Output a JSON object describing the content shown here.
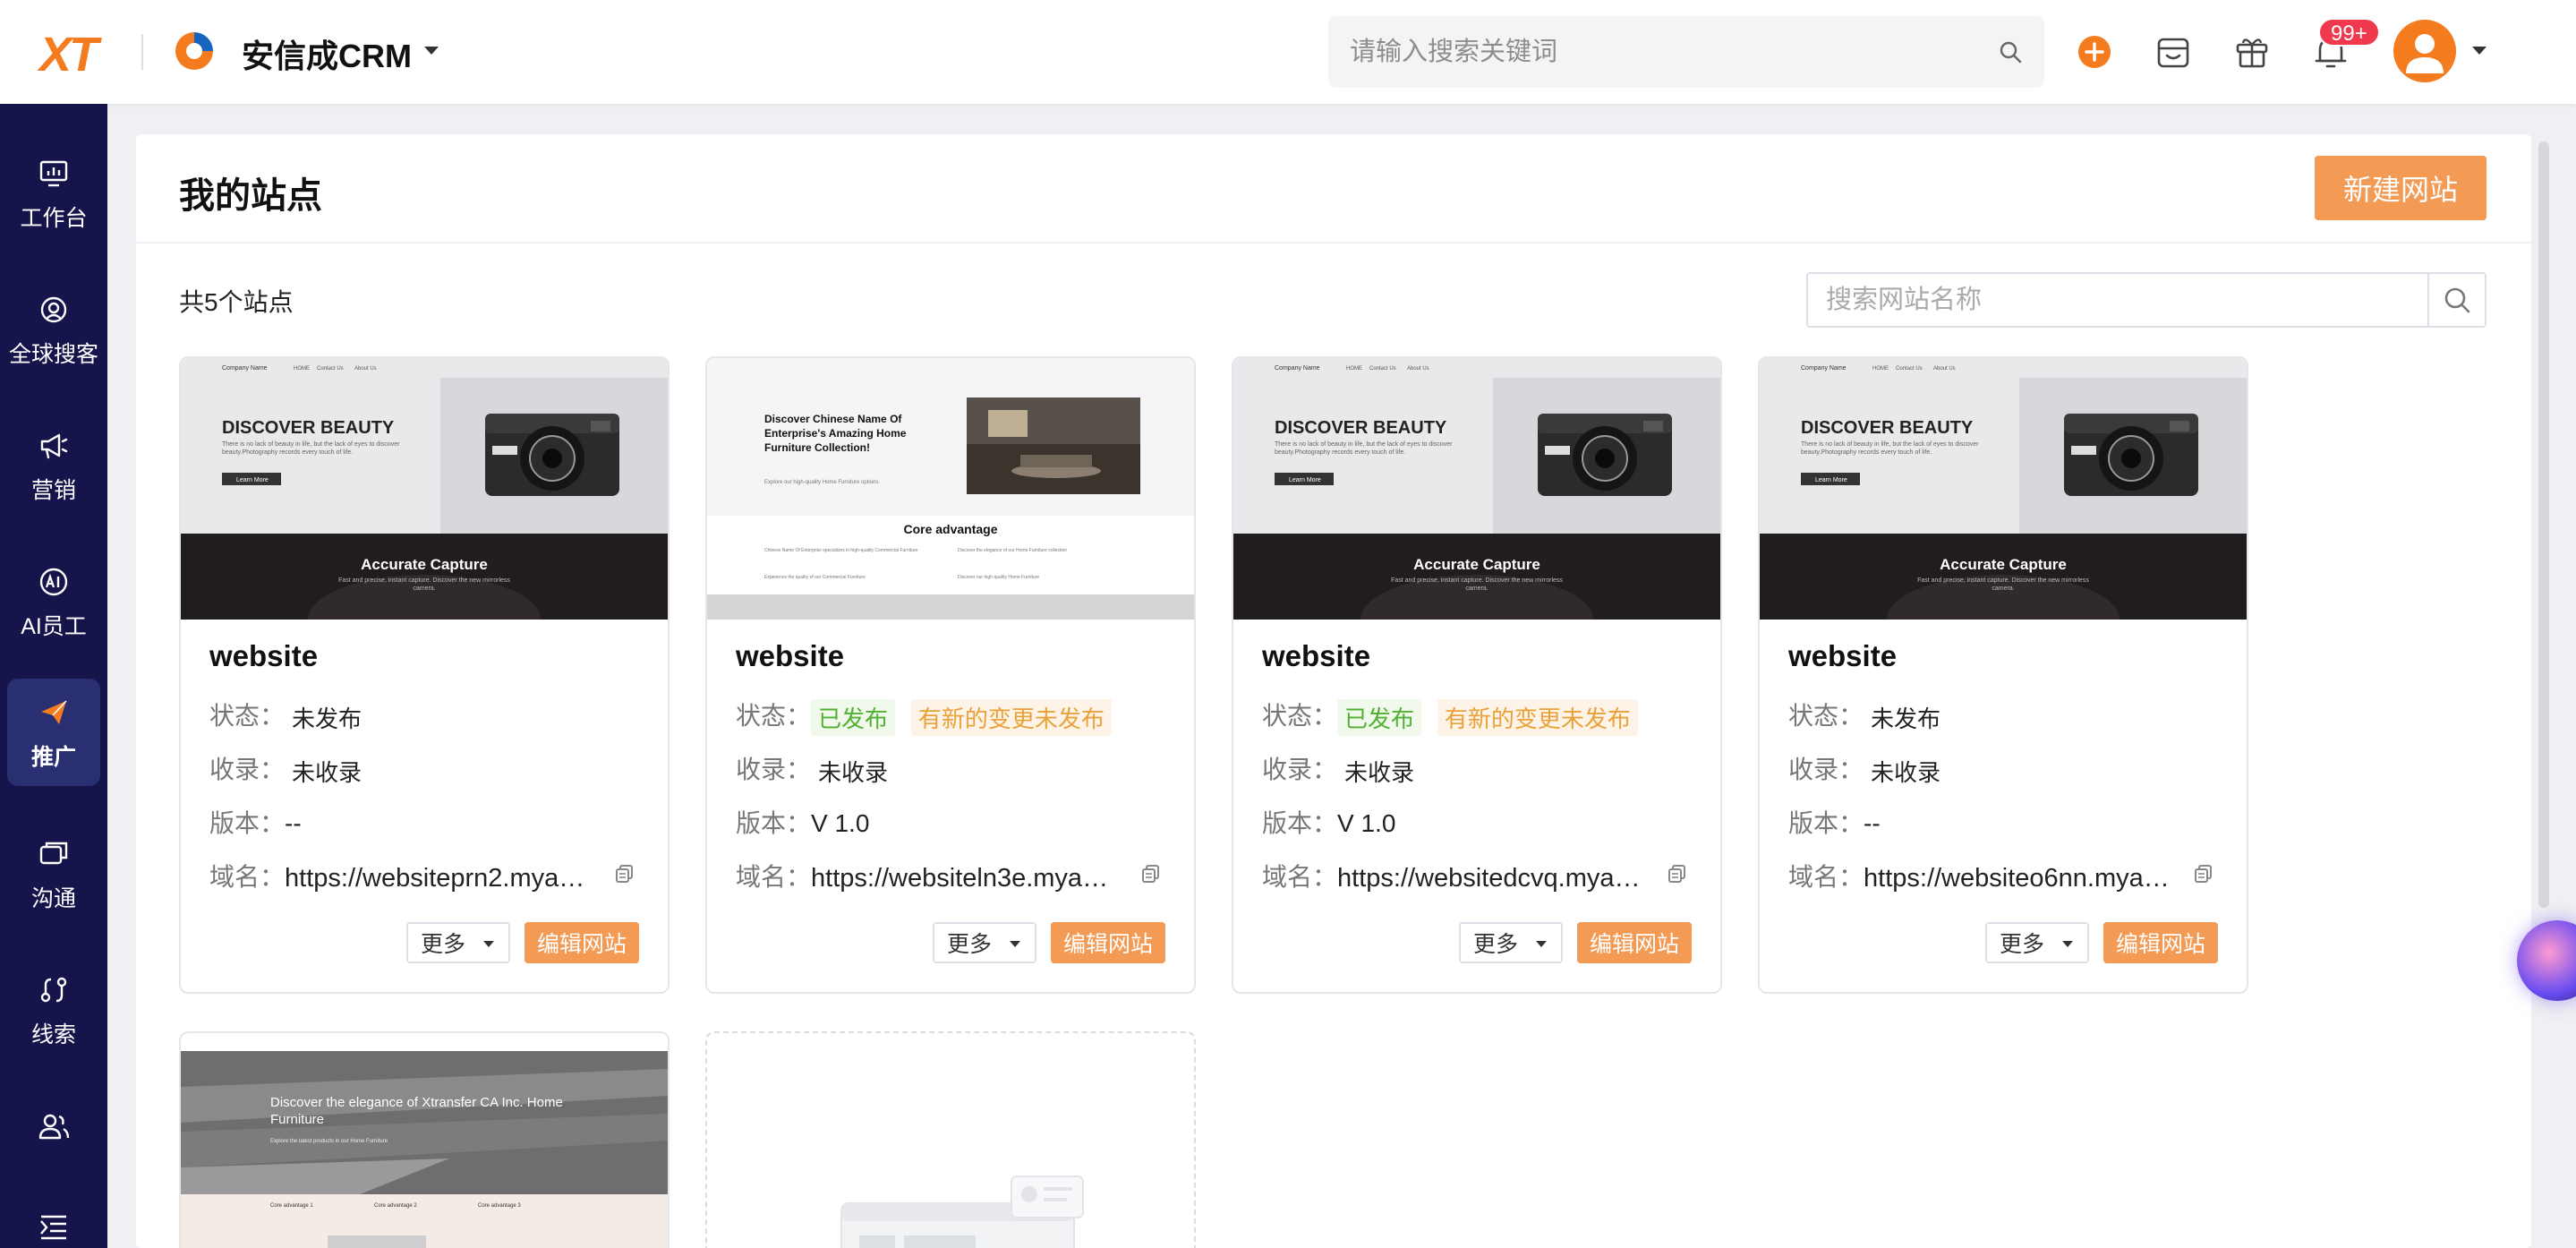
{
  "header": {
    "brand": "XT",
    "app_title": "安信成CRM",
    "search_placeholder": "请输入搜索关键词",
    "notification_badge": "99+",
    "accent": "#f47b1e"
  },
  "sidebar": {
    "items": [
      {
        "label": "工作台",
        "icon": "dashboard-icon"
      },
      {
        "label": "全球搜客",
        "icon": "global-search-icon"
      },
      {
        "label": "营销",
        "icon": "megaphone-icon"
      },
      {
        "label": "AI员工",
        "icon": "ai-icon"
      },
      {
        "label": "推广",
        "icon": "paper-plane-icon",
        "active": true
      },
      {
        "label": "沟通",
        "icon": "chat-icon"
      },
      {
        "label": "线索",
        "icon": "leads-icon"
      },
      {
        "label": "",
        "icon": "contacts-icon"
      },
      {
        "label": "",
        "icon": "menu-collapse-icon"
      }
    ]
  },
  "page": {
    "title": "我的站点",
    "new_site_label": "新建网站",
    "site_count": "共5个站点",
    "site_search_placeholder": "搜索网站名称"
  },
  "labels": {
    "status": "状态：",
    "indexed": "收录：",
    "version": "版本：",
    "domain": "域名：",
    "more": "更多",
    "edit": "编辑网站"
  },
  "sites": [
    {
      "name": "website",
      "status": "未发布",
      "status_extra": "",
      "indexed": "未收录",
      "version": "--",
      "domain": "https://websiteprn2.myadmin.cn",
      "thumb": {
        "company": "Company Name",
        "nav": [
          "HOME",
          "Contact Us",
          "About Us"
        ],
        "hero": "DISCOVER BEAUTY",
        "hero_sub": "There is no lack of beauty in life, but the lack of eyes to discover beauty.Photography records every touch of life.",
        "cta": "Learn More",
        "band_title": "Accurate Capture",
        "band_sub": "Fast and precise, instant capture. Discover the new mirrorless camera."
      }
    },
    {
      "name": "website",
      "status": "已发布",
      "status_extra": "有新的变更未发布",
      "indexed": "未收录",
      "version": "V 1.0",
      "domain": "https://websiteln3e.myadmin.cn",
      "thumb": {
        "hero": "Discover Chinese Name Of Enterprise's Amazing Home Furniture Collection!",
        "hero_sub": "Explore our high-quality Home Furniture options.",
        "band_title": "Core advantage",
        "features": [
          "Chinese Name Of Enterprise specializes in high-quality Commercial Furniture",
          "Discover the elegance of our Home Furniture collection",
          "Experience the quality of our Commercial Furniture",
          "Discover our high-quality Home Furniture"
        ]
      }
    },
    {
      "name": "website",
      "status": "已发布",
      "status_extra": "有新的变更未发布",
      "indexed": "未收录",
      "version": "V 1.0",
      "domain": "https://websitedcvq.myadmin.cn",
      "thumb": {
        "company": "Company Name",
        "nav": [
          "HOME",
          "Contact Us",
          "About Us"
        ],
        "hero": "DISCOVER BEAUTY",
        "hero_sub": "There is no lack of beauty in life, but the lack of eyes to discover beauty.Photography records every touch of life.",
        "cta": "Learn More",
        "band_title": "Accurate Capture",
        "band_sub": "Fast and precise, instant capture. Discover the new mirrorless camera."
      }
    },
    {
      "name": "website",
      "status": "未发布",
      "status_extra": "",
      "indexed": "未收录",
      "version": "--",
      "domain": "https://websiteo6nn.myadmin.cn",
      "thumb": {
        "company": "Company Name",
        "nav": [
          "HOME",
          "Contact Us",
          "About Us"
        ],
        "hero": "DISCOVER BEAUTY",
        "hero_sub": "There is no lack of beauty in life, but the lack of eyes to discover beauty.Photography records every touch of life.",
        "cta": "Learn More",
        "band_title": "Accurate Capture",
        "band_sub": "Fast and precise, instant capture. Discover the new mirrorless camera."
      }
    },
    {
      "name": "",
      "thumb": {
        "hero": "Discover the elegance of Xtransfer CA Inc. Home Furniture",
        "hero_sub": "Explore the latest products in our Home Furniture",
        "features": [
          "Core advantage 1",
          "Core advantage 2",
          "Core advantage 3"
        ]
      }
    }
  ]
}
